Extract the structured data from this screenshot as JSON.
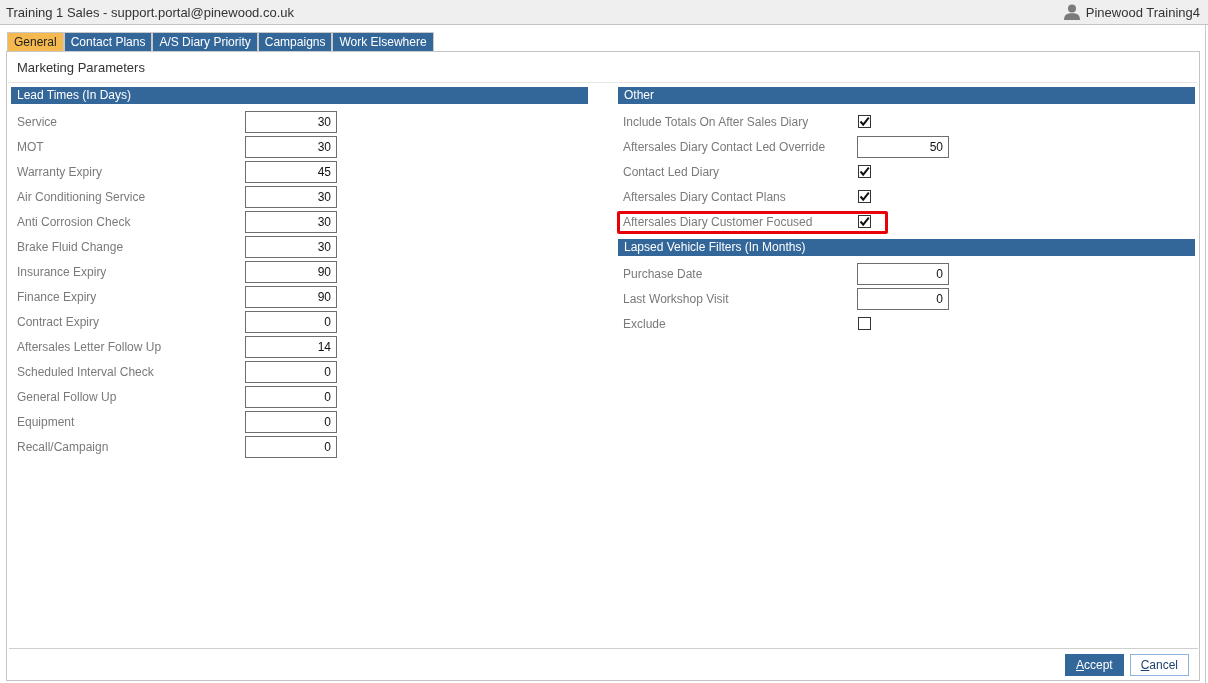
{
  "window": {
    "title": "Training 1 Sales - support.portal@pinewood.co.uk"
  },
  "user": {
    "name": "Pinewood Training4"
  },
  "tabs": [
    {
      "label": "General",
      "selected": true
    },
    {
      "label": "Contact Plans",
      "selected": false
    },
    {
      "label": "A/S Diary Priority",
      "selected": false
    },
    {
      "label": "Campaigns",
      "selected": false
    },
    {
      "label": "Work Elsewhere",
      "selected": false
    }
  ],
  "page": {
    "title": "Marketing Parameters"
  },
  "lead_times": {
    "title": "Lead Times (In Days)",
    "items": [
      {
        "kind": "number",
        "label": "Service",
        "value": "30"
      },
      {
        "kind": "number",
        "label": "MOT",
        "value": "30"
      },
      {
        "kind": "number",
        "label": "Warranty Expiry",
        "value": "45"
      },
      {
        "kind": "number",
        "label": "Air Conditioning Service",
        "value": "30"
      },
      {
        "kind": "number",
        "label": "Anti Corrosion Check",
        "value": "30"
      },
      {
        "kind": "number",
        "label": "Brake Fluid Change",
        "value": "30"
      },
      {
        "kind": "number",
        "label": "Insurance Expiry",
        "value": "90"
      },
      {
        "kind": "number",
        "label": "Finance Expiry",
        "value": "90"
      },
      {
        "kind": "number",
        "label": "Contract Expiry",
        "value": "0"
      },
      {
        "kind": "number",
        "label": "Aftersales Letter Follow Up",
        "value": "14"
      },
      {
        "kind": "number",
        "label": "Scheduled Interval Check",
        "value": "0"
      },
      {
        "kind": "number",
        "label": "General Follow Up",
        "value": "0"
      },
      {
        "kind": "number",
        "label": "Equipment",
        "value": "0"
      },
      {
        "kind": "number",
        "label": "Recall/Campaign",
        "value": "0"
      }
    ]
  },
  "other": {
    "title": "Other",
    "items": [
      {
        "kind": "checkbox",
        "label": "Include Totals On After Sales Diary",
        "checked": true,
        "highlighted": false
      },
      {
        "kind": "number",
        "label": "Aftersales Diary Contact Led Override",
        "value": "50",
        "highlighted": false
      },
      {
        "kind": "checkbox",
        "label": "Contact Led Diary",
        "checked": true,
        "highlighted": false
      },
      {
        "kind": "checkbox",
        "label": "Aftersales Diary Contact Plans",
        "checked": true,
        "highlighted": false
      },
      {
        "kind": "checkbox",
        "label": "Aftersales Diary Customer Focused",
        "checked": true,
        "highlighted": true
      }
    ]
  },
  "lapsed_vehicle_filters": {
    "title": "Lapsed Vehicle Filters (In Months)",
    "items": [
      {
        "kind": "number",
        "label": "Purchase Date",
        "value": "0"
      },
      {
        "kind": "number",
        "label": "Last Workshop Visit",
        "value": "0"
      },
      {
        "kind": "checkbox",
        "label": "Exclude",
        "checked": false
      }
    ]
  },
  "buttons": [
    {
      "label": "Accept",
      "kind": "primary"
    },
    {
      "label": "Cancel",
      "kind": "secondary"
    }
  ]
}
